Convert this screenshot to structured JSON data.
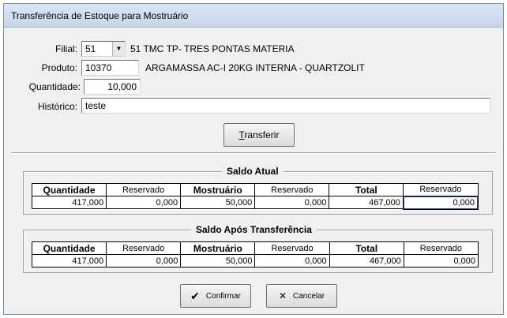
{
  "window": {
    "title": "Transferência de Estoque para Mostruário"
  },
  "form": {
    "filial_label": "Filial:",
    "filial_value": "51",
    "filial_name": "51 TMC TP- TRES PONTAS MATERIA",
    "produto_label": "Produto:",
    "produto_value": "10370",
    "produto_desc": "ARGAMASSA AC-I 20KG INTERNA - QUARTZOLIT",
    "quantidade_label": "Quantidade:",
    "quantidade_value": "10,000",
    "historico_label": "Histórico:",
    "historico_value": "teste"
  },
  "transferir_button": {
    "accel": "T",
    "rest": "ransferir"
  },
  "saldo_atual": {
    "title": "Saldo Atual",
    "headers": [
      "Quantidade",
      "Reservado",
      "Mostruário",
      "Reservado",
      "Total",
      "Reservado"
    ],
    "values": [
      "417,000",
      "0,000",
      "50,000",
      "0,000",
      "467,000",
      "0,000"
    ]
  },
  "saldo_apos": {
    "title": "Saldo Após Transferência",
    "headers": [
      "Quantidade",
      "Reservado",
      "Mostruário",
      "Reservado",
      "Total",
      "Reservado"
    ],
    "values": [
      "417,000",
      "0,000",
      "50,000",
      "0,000",
      "467,000",
      "0,000"
    ]
  },
  "buttons": {
    "confirmar": "Confirmar",
    "cancelar": "Cancelar"
  },
  "icons": {
    "confirmar": "check-icon",
    "cancelar": "cancel-x-icon",
    "combo": "chevron-down-icon"
  }
}
